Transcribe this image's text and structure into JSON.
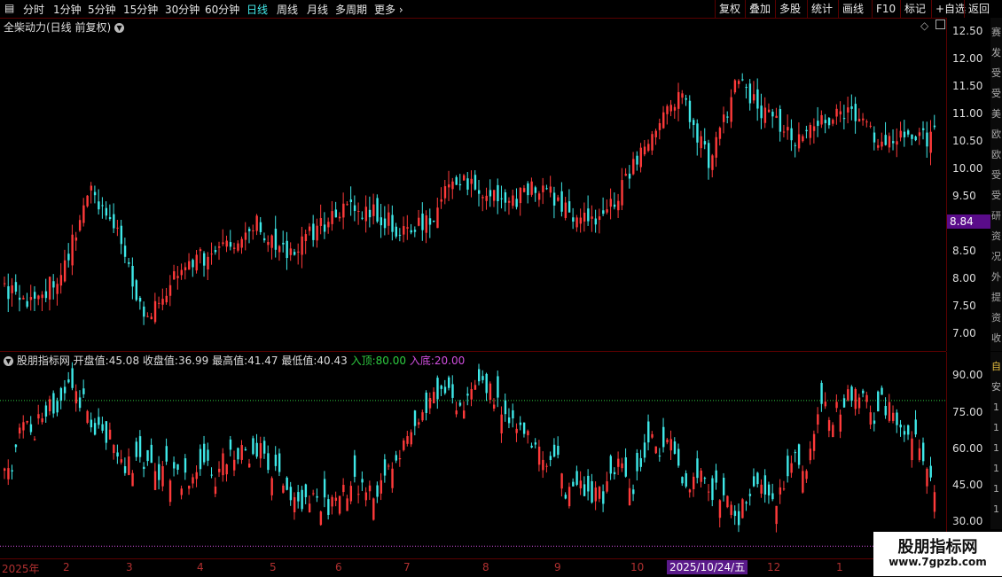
{
  "toolbar": {
    "periods": [
      "分时",
      "1分钟",
      "5分钟",
      "15分钟",
      "30分钟",
      "60分钟",
      "日线",
      "周线",
      "月线",
      "多周期",
      "更多"
    ],
    "active_period": "日线",
    "right_buttons": [
      "复权",
      "叠加",
      "多股",
      "统计",
      "画线",
      "F10",
      "标记",
      "+自选",
      "返回"
    ]
  },
  "main_panel": {
    "title": "全柴动力(日线 前复权)",
    "price_axis": [
      "12.50",
      "12.00",
      "11.50",
      "11.00",
      "10.50",
      "10.00",
      "9.50",
      "9.00",
      "8.50",
      "8.00",
      "7.50",
      "7.00"
    ],
    "current_price": "8.84"
  },
  "indicator_panel": {
    "name": "股朋指标网",
    "open_label": "开盘值:",
    "open_value": "45.08",
    "close_label": "收盘值:",
    "close_value": "36.99",
    "high_label": "最高值:",
    "high_value": "41.47",
    "low_label": "最低值:",
    "low_value": "40.43",
    "top_label": "入顶:",
    "top_value": "80.00",
    "bottom_label": "入底:",
    "bottom_value": "20.00",
    "axis": [
      "90.00",
      "75.00",
      "60.00",
      "45.00",
      "30.00"
    ]
  },
  "date_axis": {
    "labels": [
      "2025年",
      "2",
      "3",
      "4",
      "5",
      "6",
      "7",
      "8",
      "9",
      "10",
      "12",
      "1"
    ],
    "selected": "2025/10/24/五"
  },
  "right_strip": {
    "top_chars": [
      "赛",
      "发",
      "受",
      "受",
      "美",
      "欧",
      "欧",
      "受",
      "受",
      "研",
      "资",
      "况",
      "外",
      "提",
      "资",
      "收"
    ],
    "bottom_chars": [
      "自",
      "安",
      "1",
      "1",
      "1",
      "1",
      "1",
      "1"
    ]
  },
  "watermark": {
    "title": "股朋指标网",
    "url": "www.7gpzb.com"
  },
  "colors": {
    "up": "#ff3a3a",
    "down": "#3ee8e8",
    "top_line": "#2ecc40",
    "bottom_line": "#d14fe0",
    "accent": "#5a0c8a"
  },
  "chart_data": [
    {
      "type": "candlestick",
      "title": "全柴动力(日线 前复权)",
      "ylim": [
        6.7,
        12.75
      ],
      "months": [
        "2025-01",
        "2025-02",
        "2025-03",
        "2025-04",
        "2025-05",
        "2025-06",
        "2025-07",
        "2025-08",
        "2025-09",
        "2025-10",
        "2025-11",
        "2025-12",
        "2026-01"
      ],
      "close": [
        7.8,
        7.6,
        8.1,
        9.6,
        8.9,
        7.2,
        8.0,
        8.4,
        8.7,
        9.0,
        8.4,
        8.9,
        9.2,
        9.3,
        8.9,
        9.0,
        9.9,
        9.6,
        9.4,
        9.7,
        9.2,
        9.0,
        9.7,
        10.8,
        11.4,
        10.1,
        11.6,
        11.0,
        10.5,
        10.9,
        11.0,
        10.6,
        10.55,
        10.6
      ],
      "current": 8.84
    },
    {
      "type": "line",
      "title": "股朋指标网",
      "ylim": [
        15,
        100
      ],
      "reference_lines": {
        "入顶": 80,
        "入底": 20
      },
      "values": [
        45.08,
        36.99,
        41.47,
        40.43
      ]
    }
  ]
}
